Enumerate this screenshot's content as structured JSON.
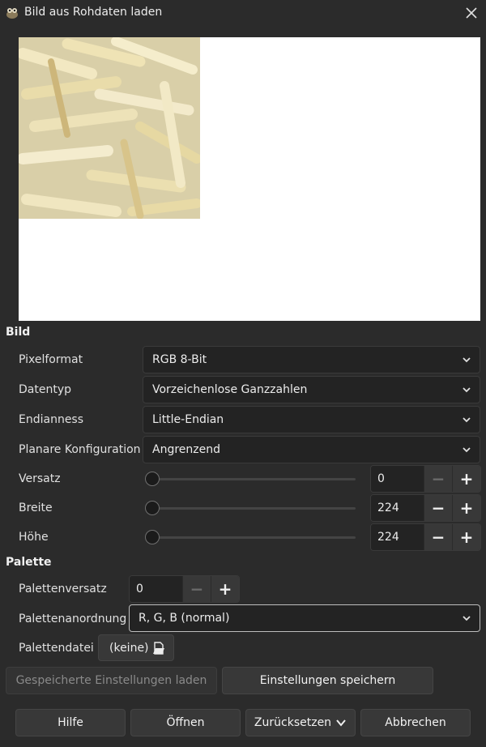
{
  "window": {
    "title": "Bild aus Rohdaten laden",
    "icon": "gimp-wilber-icon"
  },
  "sections": {
    "image": "Bild",
    "palette": "Palette"
  },
  "image": {
    "pixel_format": {
      "label": "Pixelformat",
      "value": "RGB 8-Bit"
    },
    "data_type": {
      "label": "Datentyp",
      "value": "Vorzeichenlose Ganzzahlen"
    },
    "endianness": {
      "label": "Endianness",
      "value": "Little-Endian"
    },
    "planar": {
      "label": "Planare Konfiguration",
      "value": "Angrenzend"
    },
    "offset": {
      "label": "Versatz",
      "value": "0"
    },
    "width": {
      "label": "Breite",
      "value": "224"
    },
    "height": {
      "label": "Höhe",
      "value": "224"
    }
  },
  "palette": {
    "offset": {
      "label": "Palettenversatz",
      "value": "0"
    },
    "order": {
      "label": "Palettenanordnung",
      "value": "R, G, B (normal)"
    },
    "file": {
      "label": "Palettendatei",
      "value": "(keine)"
    }
  },
  "settings": {
    "load_label": "Gespeicherte Einstellungen laden",
    "save_label": "Einstellungen speichern"
  },
  "footer": {
    "help": "Hilfe",
    "open": "Öffnen",
    "reset": "Zurücksetzen",
    "cancel": "Abbrechen"
  },
  "spin_symbols": {
    "minus": "−",
    "plus": "+"
  }
}
